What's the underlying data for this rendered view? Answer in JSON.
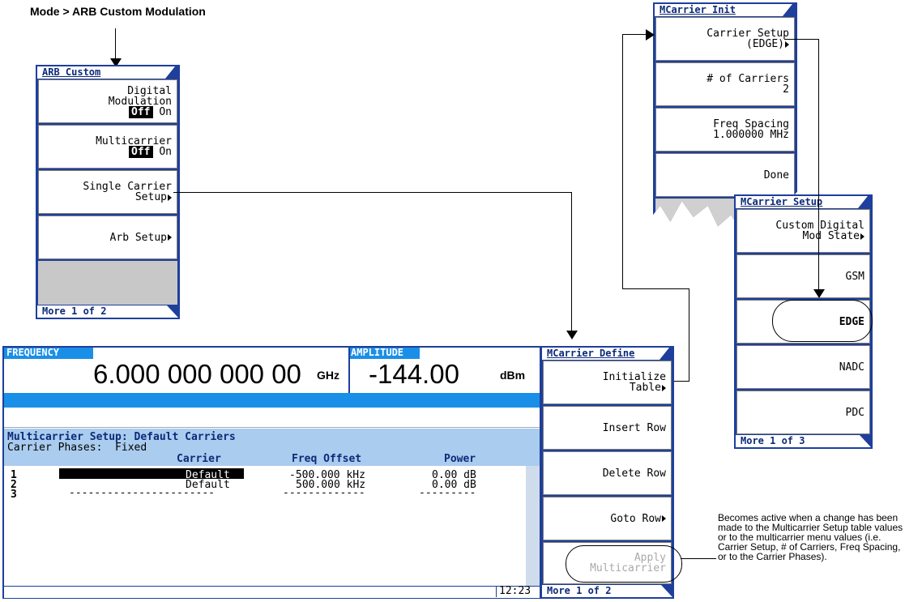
{
  "caption": "Mode > ARB Custom Modulation",
  "arb_custom": {
    "title": "ARB Custom",
    "keys": [
      {
        "l1": "Digital",
        "l2": "Modulation",
        "off": "Off",
        "on": "On"
      },
      {
        "l1": "Multicarrier",
        "off": "Off",
        "on": "On"
      },
      {
        "l1": "Single Carrier",
        "l2": "Setup"
      },
      {
        "l1": "Arb Setup"
      }
    ],
    "more": "More 1 of 2"
  },
  "mcarrier_init": {
    "title": "MCarrier Init",
    "keys": [
      {
        "l1": "Carrier Setup",
        "l2": "(EDGE)"
      },
      {
        "l1": "# of Carriers",
        "l2": "2"
      },
      {
        "l1": "Freq Spacing",
        "l2": "1.000000 MHz"
      },
      {
        "l1": "Done"
      }
    ]
  },
  "mcarrier_setup": {
    "title": "MCarrier Setup",
    "keys": [
      {
        "l1": "Custom Digital",
        "l2": "Mod State"
      },
      {
        "l1": "GSM"
      },
      {
        "l1": "EDGE"
      },
      {
        "l1": "NADC"
      },
      {
        "l1": "PDC"
      }
    ],
    "more": "More 1 of 3"
  },
  "screen": {
    "freq_label": "FREQUENCY",
    "freq_value": "6.000 000 000 00",
    "freq_unit": "GHz",
    "amp_label": "AMPLITUDE",
    "amp_value": "-144.00",
    "amp_unit": "dBm",
    "table_title": "Multicarrier Setup: Default Carriers",
    "phases": "Carrier Phases:  Fixed",
    "columns": [
      "Carrier",
      "Freq Offset",
      "Power"
    ],
    "rows": [
      {
        "n": "1",
        "carrier": "Default",
        "offset": "-500.000 kHz",
        "power": "0.00 dB"
      },
      {
        "n": "2",
        "carrier": "Default",
        "offset": "500.000 kHz",
        "power": "0.00 dB"
      },
      {
        "n": "3",
        "carrier": "-----------------------",
        "offset": "-------------",
        "power": "---------"
      }
    ],
    "time": "12:23"
  },
  "mcarrier_define": {
    "title": "MCarrier Define",
    "keys": [
      {
        "l1": "Initialize",
        "l2": "Table"
      },
      {
        "l1": "Insert Row"
      },
      {
        "l1": "Delete Row"
      },
      {
        "l1": "Goto Row"
      },
      {
        "l1": "Apply",
        "l2": "Multicarrier"
      }
    ],
    "more": "More 1 of 2"
  },
  "note": "Becomes active when a change has been made to the Multicarrier Setup table values or to the multicarrier menu values (i.e. Carrier Setup, # of Carriers, Freq Spacing, or to the Carrier Phases).",
  "colors": {
    "panel_blue": "#1e3f9c",
    "header_blue": "#1a8fe8",
    "table_bg": "#aaccee"
  }
}
